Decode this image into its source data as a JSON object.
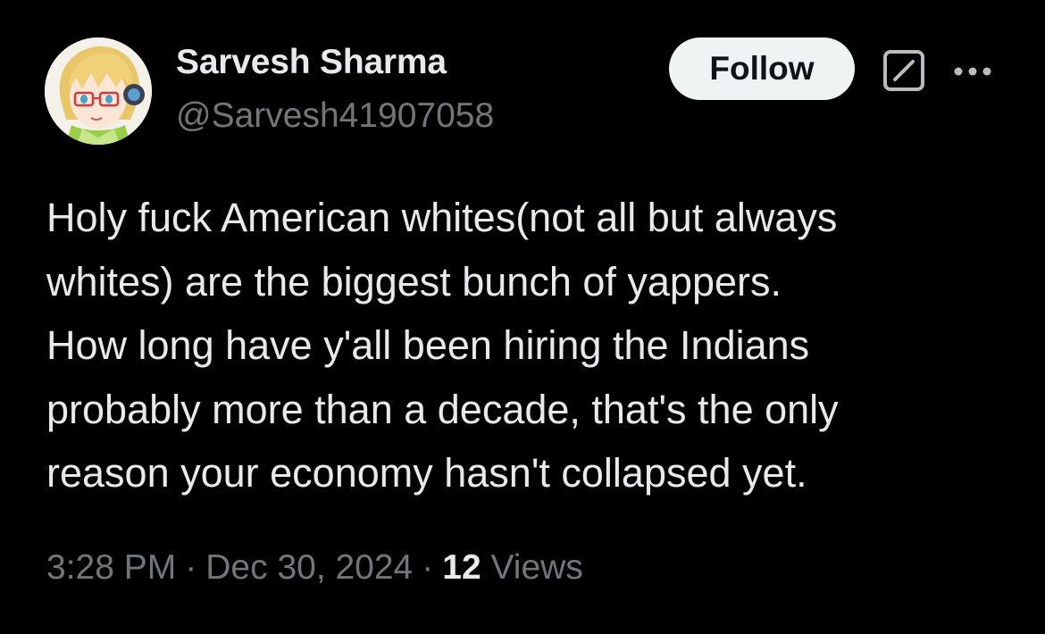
{
  "author": {
    "display_name": "Sarvesh Sharma",
    "handle": "@Sarvesh41907058",
    "avatar_icon": "anime-avatar-icon"
  },
  "actions": {
    "follow_label": "Follow",
    "grok_icon": "grok-icon",
    "more_icon": "more-icon"
  },
  "tweet": {
    "text_lines": [
      "Holy fuck American whites(not all but always",
      "whites) are the biggest bunch of yappers.",
      "How long have y'all been hiring the Indians",
      "probably more than a decade, that's the only",
      "reason your economy hasn't collapsed yet."
    ],
    "time": "3:28 PM",
    "date": "Dec 30, 2024",
    "separator": "·",
    "view_count": "12",
    "views_label": "Views"
  },
  "colors": {
    "background": "#000000",
    "text_primary": "#e7e9ea",
    "text_secondary": "#71767b",
    "follow_bg": "#eff3f4",
    "follow_text": "#0f1419"
  }
}
